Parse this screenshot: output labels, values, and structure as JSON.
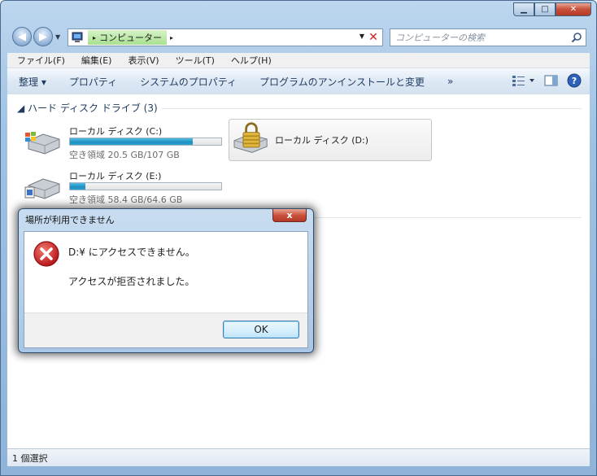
{
  "address": {
    "root_arrow": "▸",
    "segment": "コンピューター",
    "segment_arrow": "▸"
  },
  "search": {
    "placeholder": "コンピューターの検索"
  },
  "menu": [
    "ファイル(F)",
    "編集(E)",
    "表示(V)",
    "ツール(T)",
    "ヘルプ(H)"
  ],
  "toolbar": {
    "organize": "整理 ▾",
    "properties": "プロパティ",
    "system_properties": "システムのプロパティ",
    "uninstall": "プログラムのアンインストールと変更",
    "more": "»"
  },
  "group": {
    "title": "ハード ディスク ドライブ (3)"
  },
  "drives": [
    {
      "name": "ローカル ディスク (C:)",
      "free": "空き領域 20.5 GB/107 GB",
      "used_fraction": 0.81
    },
    {
      "name": "ローカル ディスク (D:)"
    },
    {
      "name": "ローカル ディスク (E:)",
      "free": "空き領域 58.4 GB/64.6 GB",
      "used_fraction": 0.1
    }
  ],
  "status": {
    "text": "1 個選択"
  },
  "dialog": {
    "title": "場所が利用できません",
    "message1": "D:¥ にアクセスできません。",
    "message2": "アクセスが拒否されました。",
    "ok": "OK",
    "close": "x"
  },
  "colors": {
    "accent": "#1f8fc0",
    "error": "#c8282d"
  }
}
